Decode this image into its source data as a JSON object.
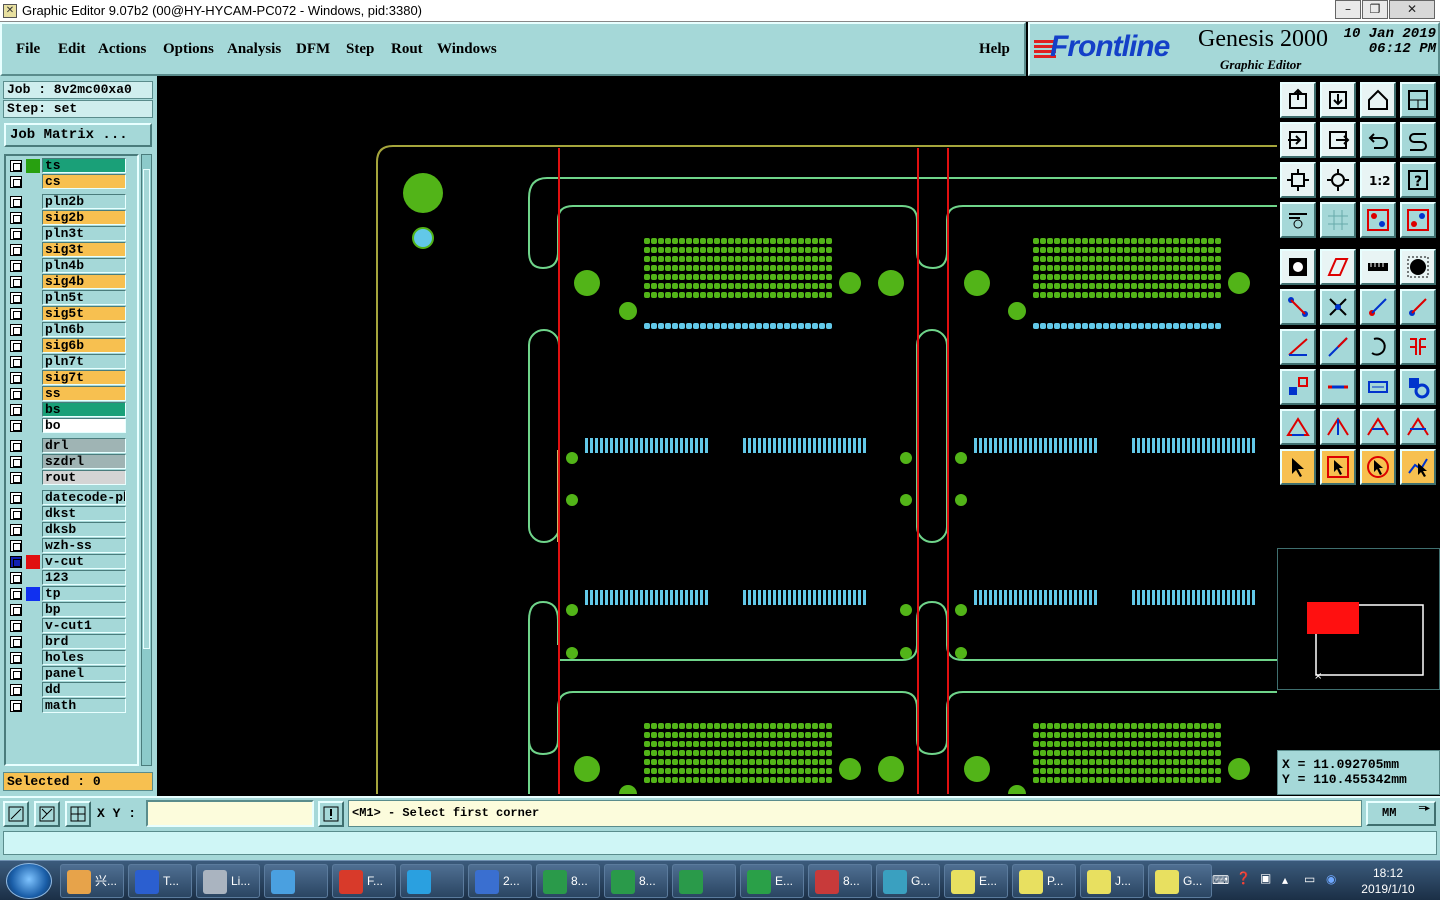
{
  "window": {
    "title": "Graphic Editor 9.07b2 (00@HY-HYCAM-PC072 - Windows, pid:3380)",
    "controls": [
      "minimize",
      "restore",
      "close"
    ]
  },
  "menu": {
    "items": [
      "File",
      "Edit",
      "Actions",
      "Options",
      "Analysis",
      "DFM",
      "Step",
      "Rout",
      "Windows"
    ],
    "help": "Help"
  },
  "brand": {
    "logo": "Frontline",
    "product": "Genesis 2000",
    "subtitle": "Graphic Editor",
    "date": "10 Jan 2019",
    "time": "06:12 PM"
  },
  "job": {
    "job_label": "Job : 8v2mc00xa0",
    "step_label": "Step: set",
    "matrix_button": "Job Matrix ..."
  },
  "layers": [
    {
      "name": "ts",
      "color": "#1aa078",
      "swatch": "#28a010"
    },
    {
      "name": "cs",
      "color": "#f7c050",
      "swatch": ""
    },
    {
      "name": "pln2b",
      "color": "#a5d8d8",
      "swatch": ""
    },
    {
      "name": "sig2b",
      "color": "#f7c050",
      "swatch": ""
    },
    {
      "name": "pln3t",
      "color": "#a5d8d8",
      "swatch": ""
    },
    {
      "name": "sig3t",
      "color": "#f7c050",
      "swatch": ""
    },
    {
      "name": "pln4b",
      "color": "#a5d8d8",
      "swatch": ""
    },
    {
      "name": "sig4b",
      "color": "#f7c050",
      "swatch": ""
    },
    {
      "name": "pln5t",
      "color": "#a5d8d8",
      "swatch": ""
    },
    {
      "name": "sig5t",
      "color": "#f7c050",
      "swatch": ""
    },
    {
      "name": "pln6b",
      "color": "#a5d8d8",
      "swatch": ""
    },
    {
      "name": "sig6b",
      "color": "#f7c050",
      "swatch": ""
    },
    {
      "name": "pln7t",
      "color": "#a5d8d8",
      "swatch": ""
    },
    {
      "name": "sig7t",
      "color": "#f7c050",
      "swatch": ""
    },
    {
      "name": "ss",
      "color": "#f7c050",
      "swatch": ""
    },
    {
      "name": "bs",
      "color": "#1aa078",
      "swatch": ""
    },
    {
      "name": "bo",
      "color": "#ffffff",
      "swatch": ""
    },
    {
      "name": "drl",
      "color": "#9fb4b4",
      "swatch": ""
    },
    {
      "name": "szdrl",
      "color": "#9fb4b4",
      "swatch": ""
    },
    {
      "name": "rout",
      "color": "#d4d4d4",
      "swatch": ""
    },
    {
      "name": "datecode-pbe",
      "color": "#a5d8d8",
      "swatch": ""
    },
    {
      "name": "dkst",
      "color": "#a5d8d8",
      "swatch": ""
    },
    {
      "name": "dksb",
      "color": "#a5d8d8",
      "swatch": ""
    },
    {
      "name": "wzh-ss",
      "color": "#a5d8d8",
      "swatch": ""
    },
    {
      "name": "v-cut",
      "color": "#a5d8d8",
      "swatch": "#e01010"
    },
    {
      "name": "123",
      "color": "#a5d8d8",
      "swatch": ""
    },
    {
      "name": "tp",
      "color": "#a5d8d8",
      "swatch": "#1030f0"
    },
    {
      "name": "bp",
      "color": "#a5d8d8",
      "swatch": ""
    },
    {
      "name": "v-cut1",
      "color": "#a5d8d8",
      "swatch": ""
    },
    {
      "name": "brd",
      "color": "#a5d8d8",
      "swatch": ""
    },
    {
      "name": "holes",
      "color": "#a5d8d8",
      "swatch": ""
    },
    {
      "name": "panel",
      "color": "#a5d8d8",
      "swatch": ""
    },
    {
      "name": "dd",
      "color": "#a5d8d8",
      "swatch": ""
    },
    {
      "name": "math",
      "color": "#a5d8d8",
      "swatch": ""
    }
  ],
  "selected": "Selected : 0",
  "coords": {
    "x": "X = 11.092705mm",
    "y": "Y = 110.455342mm"
  },
  "status": {
    "xy_label": "X Y :",
    "xy_value": "",
    "prompt": "<M1> - Select first corner",
    "units": "MM",
    "message": ""
  },
  "taskbar": {
    "apps": [
      "兴...",
      "T...",
      "Li...",
      "",
      "F...",
      "",
      "2...",
      "8...",
      "8...",
      "",
      "E...",
      "8...",
      "G...",
      "E...",
      "P...",
      "J...",
      "G..."
    ],
    "time": "18:12",
    "date": "2019/1/10"
  },
  "colors": {
    "ui": "#a5d8d8",
    "highlight": "#f7c050",
    "profile": "#a5a53c",
    "outline": "#6fd48a",
    "pads": "#52b418",
    "smd": "#62c8e8",
    "vcut": "#e01010"
  }
}
